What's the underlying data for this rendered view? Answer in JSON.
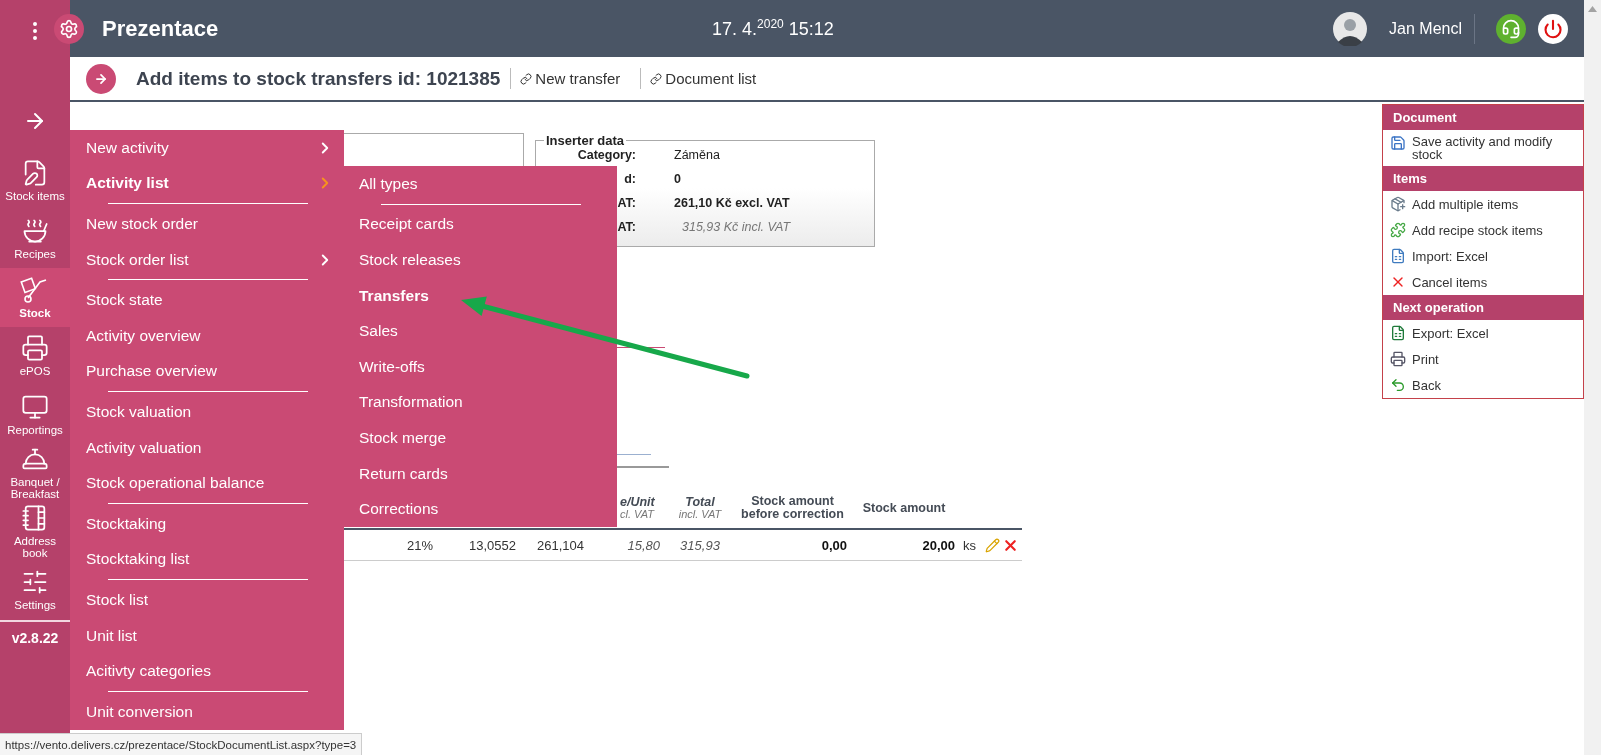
{
  "app": {
    "title": "Prezentace",
    "datetime": "17. 4.$^{2020}$ 15:12",
    "user": "Jan Mencl"
  },
  "sidebar": {
    "items": [
      {
        "label": "Stock items",
        "selected": false
      },
      {
        "label": "Recipes",
        "selected": false
      },
      {
        "label": "Stock",
        "selected": true
      },
      {
        "label": "ePOS",
        "selected": false
      },
      {
        "label": "Reportings",
        "selected": false
      },
      {
        "label": "Banquet / Breakfast",
        "selected": false
      },
      {
        "label": "Address book",
        "selected": false
      },
      {
        "label": "Settings",
        "selected": false
      }
    ],
    "version": "v2.8.22"
  },
  "page": {
    "title": "Add items to stock transfers id: 1021385",
    "links": [
      "New transfer",
      "Document list"
    ]
  },
  "inserter": {
    "legend": "Inserter data",
    "rows": [
      {
        "label": "Category:",
        "value": "Záměna",
        "kind": "plain"
      },
      {
        "label": "d:",
        "value": "0",
        "kind": "bold"
      },
      {
        "label": "AT:",
        "value": "261,10 Kč excl. VAT",
        "kind": "bold"
      },
      {
        "label": "AT:",
        "value": "315,93 Kč incl. VAT",
        "kind": "muted"
      }
    ]
  },
  "table": {
    "columns": [
      {},
      {},
      {},
      {
        "title": "e/Unit",
        "subtitle": "cl. VAT"
      },
      {
        "title": "Total",
        "subtitle": "incl. VAT"
      },
      {
        "title": "Stock amount before correction"
      },
      {
        "title": "Stock amount"
      }
    ],
    "rows": [
      {
        "cells": [
          "21%",
          "13,0552",
          "261,104",
          "15,80",
          "315,93",
          "0,00",
          "20,00",
          "ks"
        ]
      }
    ]
  },
  "menu": {
    "items": [
      {
        "label": "New activity",
        "submenu": true,
        "selected": false,
        "divider_after": false
      },
      {
        "label": "Activity list",
        "submenu": true,
        "selected": true,
        "divider_after": true
      },
      {
        "label": "New stock order",
        "submenu": false,
        "selected": false,
        "divider_after": false
      },
      {
        "label": "Stock order list",
        "submenu": true,
        "selected": false,
        "divider_after": true
      },
      {
        "label": "Stock state",
        "submenu": false,
        "selected": false,
        "divider_after": false
      },
      {
        "label": "Activity overview",
        "submenu": false,
        "selected": false,
        "divider_after": false
      },
      {
        "label": "Purchase overview",
        "submenu": false,
        "selected": false,
        "divider_after": true
      },
      {
        "label": "Stock valuation",
        "submenu": false,
        "selected": false,
        "divider_after": false
      },
      {
        "label": "Activity valuation",
        "submenu": false,
        "selected": false,
        "divider_after": false
      },
      {
        "label": "Stock operational balance",
        "submenu": false,
        "selected": false,
        "divider_after": true
      },
      {
        "label": "Stocktaking",
        "submenu": false,
        "selected": false,
        "divider_after": false
      },
      {
        "label": "Stocktaking list",
        "submenu": false,
        "selected": false,
        "divider_after": true
      },
      {
        "label": "Stock list",
        "submenu": false,
        "selected": false,
        "divider_after": false
      },
      {
        "label": "Unit list",
        "submenu": false,
        "selected": false,
        "divider_after": false
      },
      {
        "label": "Acitivty categories",
        "submenu": false,
        "selected": false,
        "divider_after": true
      },
      {
        "label": "Unit conversion",
        "submenu": false,
        "selected": false,
        "divider_after": false
      }
    ]
  },
  "submenu": {
    "items": [
      {
        "label": "All types",
        "selected": false,
        "divider_after": true
      },
      {
        "label": "Receipt cards",
        "selected": false,
        "divider_after": false
      },
      {
        "label": "Stock releases",
        "selected": false,
        "divider_after": false
      },
      {
        "label": "Transfers",
        "selected": true,
        "divider_after": false
      },
      {
        "label": "Sales",
        "selected": false,
        "divider_after": false
      },
      {
        "label": "Write-offs",
        "selected": false,
        "divider_after": false
      },
      {
        "label": "Transformation",
        "selected": false,
        "divider_after": false
      },
      {
        "label": "Stock merge",
        "selected": false,
        "divider_after": false
      },
      {
        "label": "Return cards",
        "selected": false,
        "divider_after": false
      },
      {
        "label": "Corrections",
        "selected": false,
        "divider_after": false
      }
    ]
  },
  "actions": {
    "sections": [
      {
        "title": "Document",
        "items": [
          "Save activity and modify stock"
        ]
      },
      {
        "title": "Items",
        "items": [
          "Add multiple items",
          "Add recipe stock items",
          "Import: Excel",
          "Cancel items"
        ]
      },
      {
        "title": "Next operation",
        "items": [
          "Export: Excel",
          "Print",
          "Back"
        ]
      }
    ]
  },
  "status_bar": "https://vento.delivers.cz/prezentace/StockDocumentList.aspx?type=3"
}
